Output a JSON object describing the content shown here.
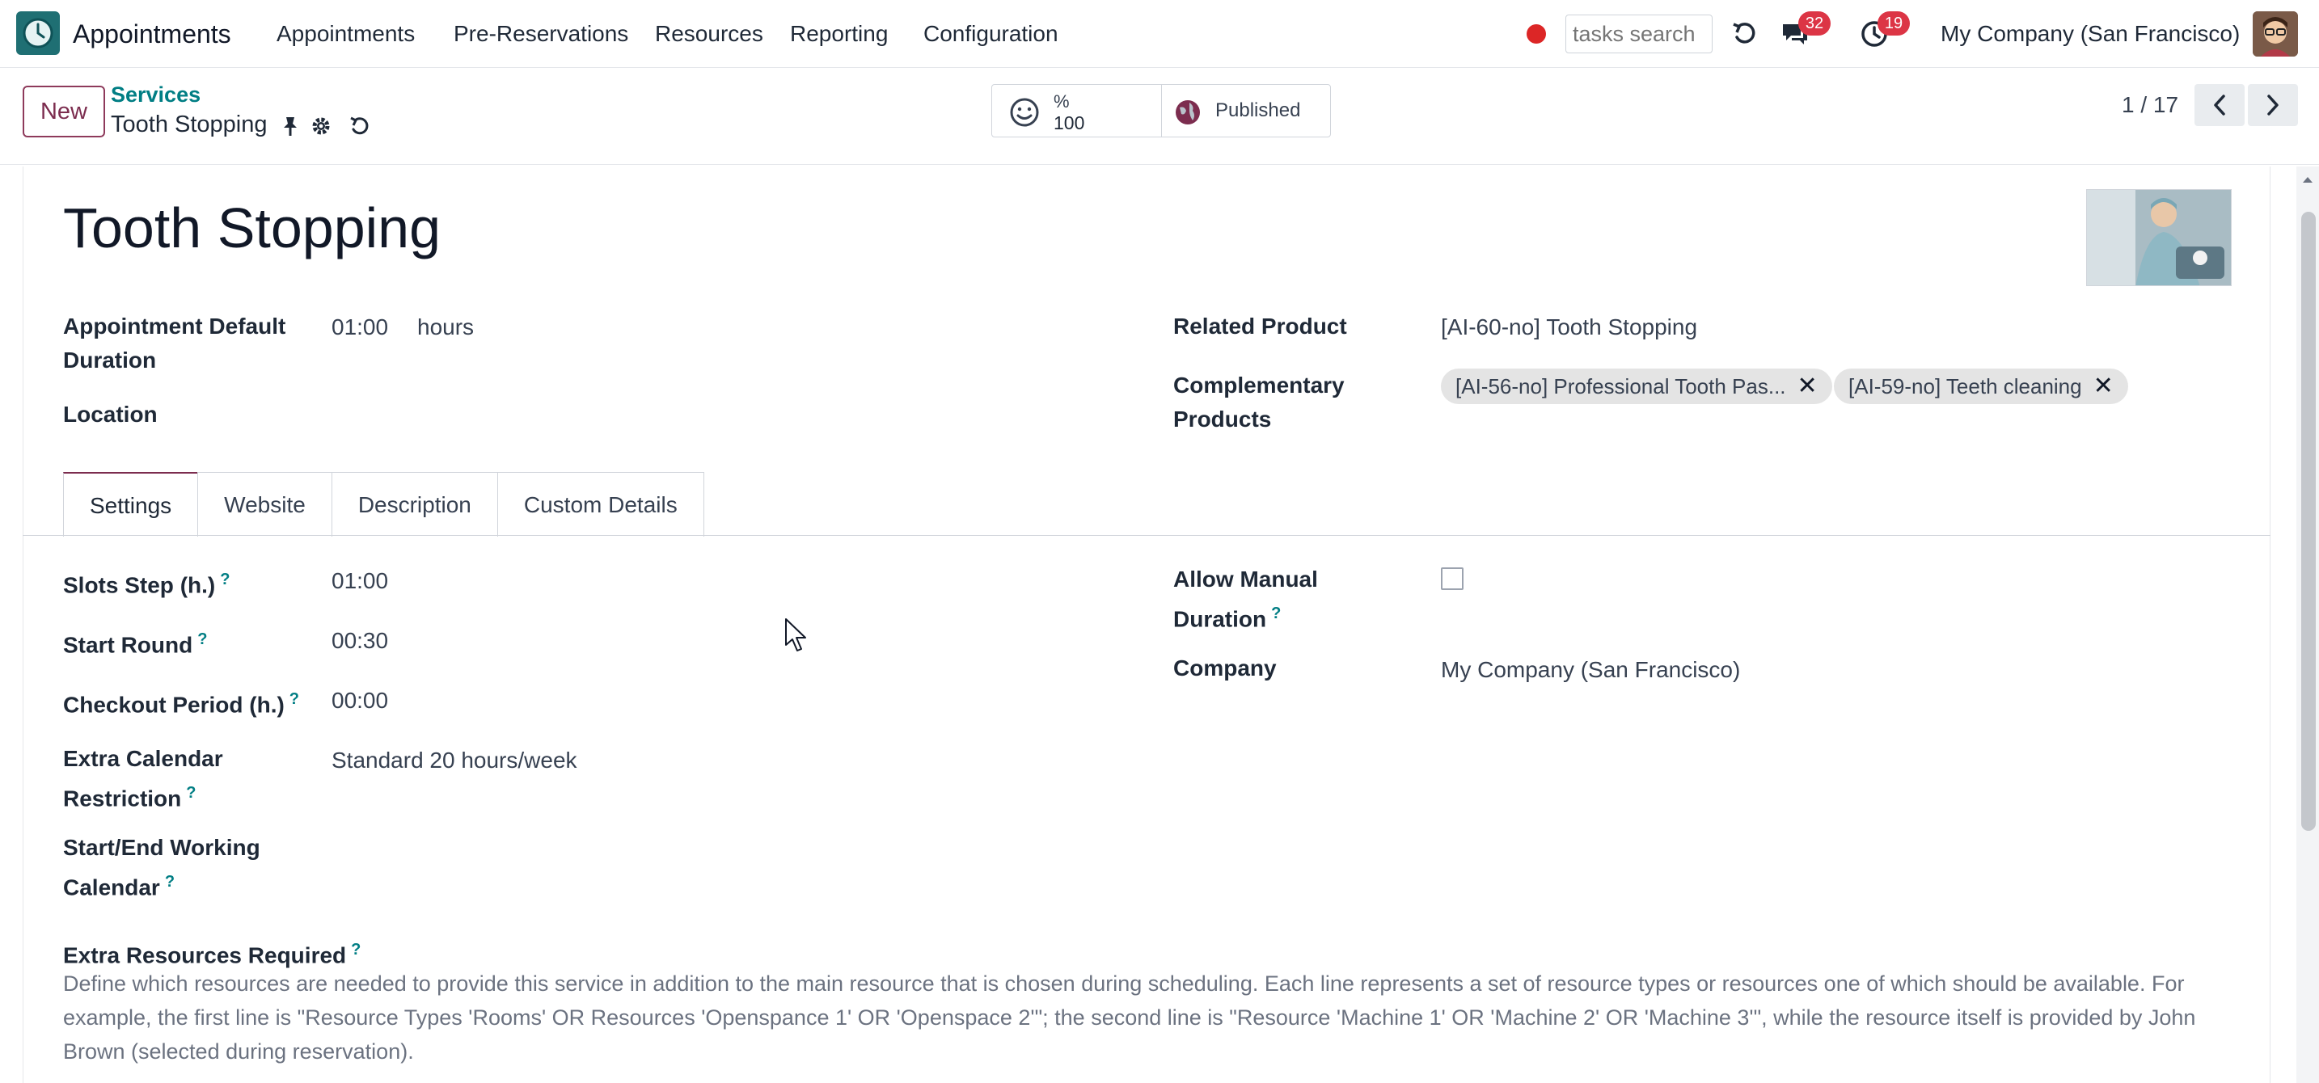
{
  "navbar": {
    "app_name": "Appointments",
    "menu": [
      "Appointments",
      "Pre-Reservations",
      "Resources",
      "Reporting",
      "Configuration"
    ],
    "search_placeholder": "tasks search",
    "messages_count": "32",
    "activities_count": "19",
    "company": "My Company (San Francisco)"
  },
  "control_panel": {
    "new_label": "New",
    "breadcrumb_parent": "Services",
    "breadcrumb_current": "Tooth Stopping",
    "stat_symbol": "%",
    "stat_value": "100",
    "published_label": "Published",
    "pager": "1 / 17"
  },
  "form": {
    "title": "Tooth Stopping",
    "left_fields": [
      {
        "label": "Appointment Default Duration",
        "value": "01:00",
        "unit": "hours"
      },
      {
        "label": "Location",
        "value": ""
      }
    ],
    "right_fields": [
      {
        "label": "Related Product",
        "value": "[AI-60-no] Tooth Stopping"
      },
      {
        "label": "Complementary Products",
        "tags": [
          "[AI-56-no] Professional Tooth Pas...",
          "[AI-59-no] Teeth cleaning"
        ]
      }
    ],
    "tabs": [
      "Settings",
      "Website",
      "Description",
      "Custom Details"
    ],
    "active_tab": "Settings",
    "settings": {
      "slots_step_label": "Slots Step (h.)",
      "slots_step_value": "01:00",
      "start_round_label": "Start Round",
      "start_round_value": "00:30",
      "checkout_label": "Checkout Period (h.)",
      "checkout_value": "00:00",
      "extra_calendar_label": "Extra Calendar Restriction",
      "extra_calendar_value": "Standard 20 hours/week",
      "working_calendar_label": "Start/End Working Calendar",
      "allow_manual_label": "Allow Manual Duration",
      "allow_manual_checked": false,
      "company_label": "Company",
      "company_value": "My Company (San Francisco)",
      "extra_resources_label": "Extra Resources Required",
      "extra_resources_help": "Define which resources are needed to provide this service in addition to the main resource that is chosen during scheduling. Each line represents a set of resource types or resources one of which should be available. For example, the first line is \"Resource Types 'Rooms' OR Resources 'Openspance 1' OR 'Openspace 2'\"; the second line is \"Resource 'Machine 1' OR 'Machine 2' OR 'Machine 3'\", while the resource itself is provided by John Brown (selected during reservation)."
    },
    "help_mark": "?"
  },
  "colors": {
    "brand": "#7c2d4f",
    "link": "#017e84",
    "badge": "#dc3545"
  }
}
